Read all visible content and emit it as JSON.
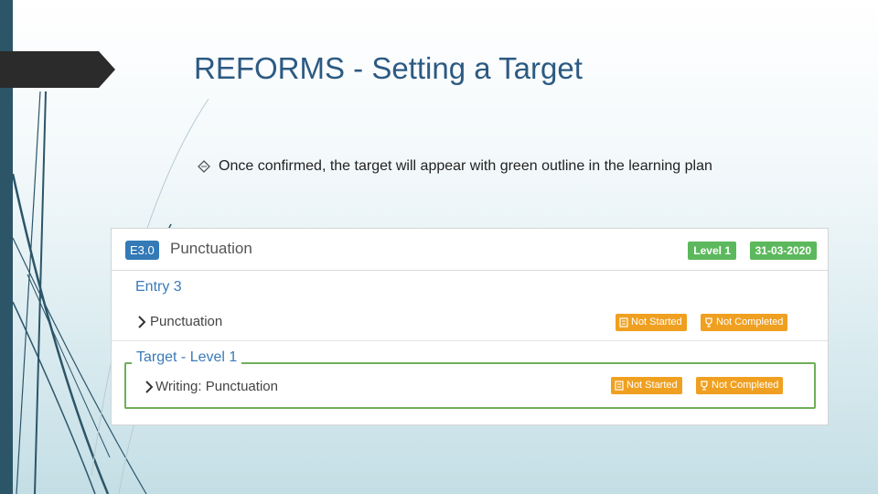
{
  "slide": {
    "title": "REFORMS - Setting a Target",
    "bullet_icon": "diamond-outline-icon",
    "bullet_text": "Once confirmed, the target will appear with green outline in the learning plan"
  },
  "colors": {
    "title": "#2c5a82",
    "left_bar": "#2c5568",
    "badge_blue": "#337ab7",
    "tag_green": "#5cb85c",
    "tag_orange": "#f0a020",
    "target_outline": "#6fae5a"
  },
  "screenshot": {
    "header": {
      "code": "E3.0",
      "title": "Punctuation",
      "level": "Level 1",
      "date": "31-03-2020"
    },
    "section_title": "Entry 3",
    "rows": [
      {
        "label": "Punctuation",
        "status": "Not Started",
        "completion": "Not Completed"
      }
    ],
    "target": {
      "legend": "Target - Level 1",
      "label": "Writing: Punctuation",
      "status": "Not Started",
      "completion": "Not Completed"
    }
  }
}
